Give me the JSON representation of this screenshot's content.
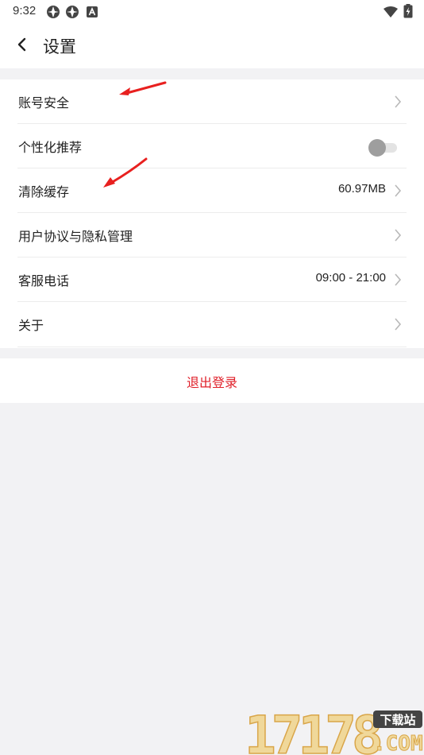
{
  "status_bar": {
    "time": "9:32",
    "icons": [
      "app-notification-icon",
      "app-notification-icon",
      "a-square-icon",
      "wifi-icon",
      "battery-icon"
    ]
  },
  "header": {
    "title": "设置",
    "back_icon": "chevron-left-icon"
  },
  "settings": {
    "items": [
      {
        "label": "账号安全",
        "value": "",
        "control": "chevron"
      },
      {
        "label": "个性化推荐",
        "value": "",
        "control": "toggle",
        "toggle_on": false
      },
      {
        "label": "清除缓存",
        "value": "60.97MB",
        "control": "chevron"
      },
      {
        "label": "用户协议与隐私管理",
        "value": "",
        "control": "chevron"
      },
      {
        "label": "客服电话",
        "value": "09:00 - 21:00",
        "control": "chevron"
      },
      {
        "label": "关于",
        "value": "",
        "control": "chevron"
      }
    ]
  },
  "logout": {
    "label": "退出登录"
  },
  "annotations": {
    "arrow_color": "#e8201f"
  },
  "watermark": {
    "number": "17178",
    "badge": "下载站",
    "domain": ".COM"
  },
  "colors": {
    "background": "#f2f2f4",
    "card": "#ffffff",
    "logout": "#e0202a",
    "divider": "#ececec",
    "chevron": "#b8b8b8"
  }
}
